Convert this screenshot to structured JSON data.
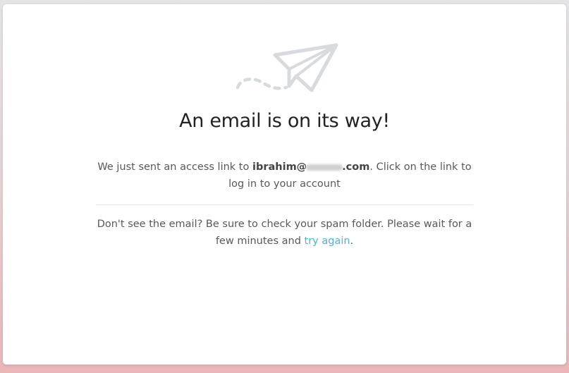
{
  "card": {
    "icon": "paper-plane-icon",
    "title": "An email is on its way!",
    "sent_prefix": "We just sent an access link to ",
    "email_user": "ibrahim@",
    "email_domain_end": ".com",
    "sent_suffix": ". Click on the link to log in to your account",
    "help_prefix": "Don't see the email? Be sure to check your spam folder. Please wait for a few minutes and ",
    "try_again_label": "try again",
    "help_suffix": "."
  },
  "colors": {
    "icon": "#d7dadf",
    "link": "#4db3cf",
    "title": "#222222",
    "text": "#55595e"
  }
}
